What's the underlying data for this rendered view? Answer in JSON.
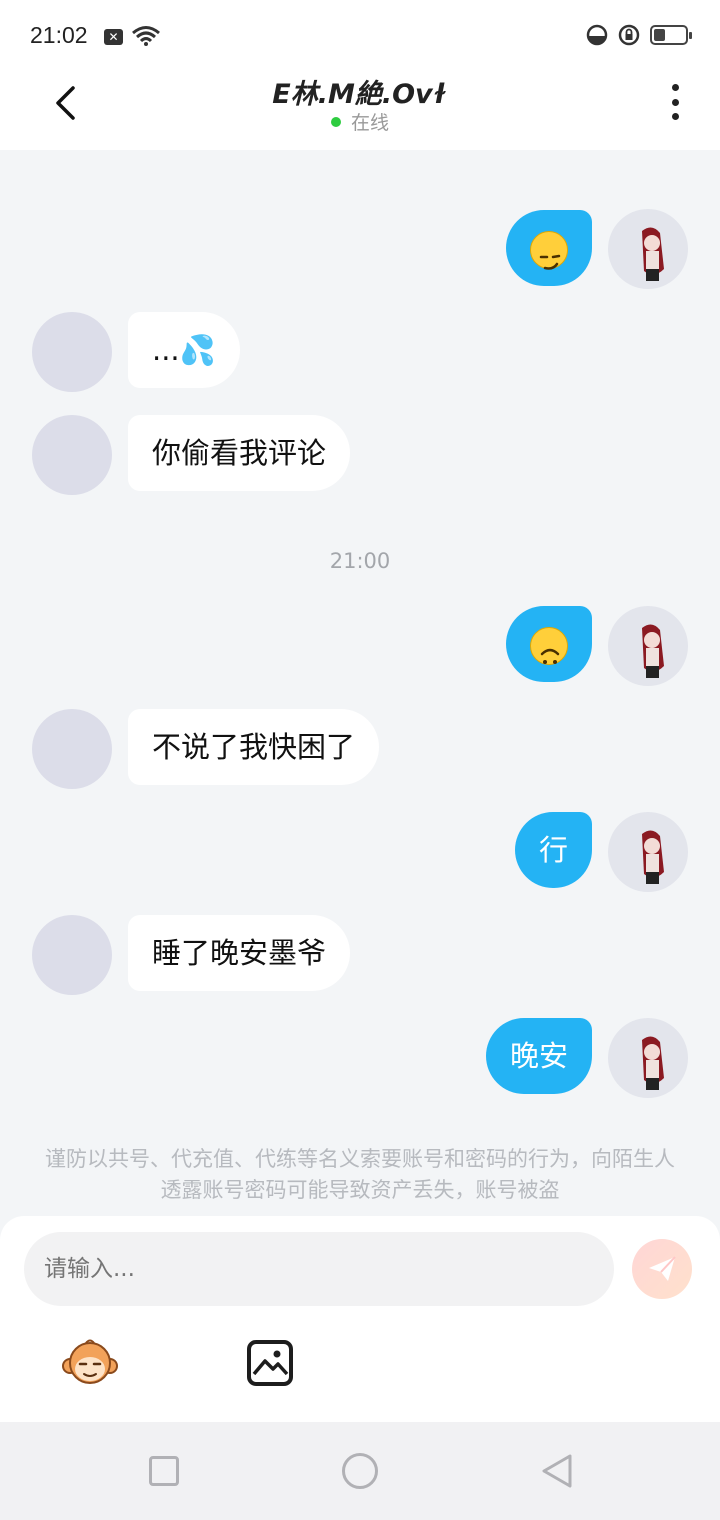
{
  "status_bar": {
    "time": "21:02",
    "battery_level": 0.35
  },
  "header": {
    "title": "E林.M絶.Ovɫ",
    "status": "在线"
  },
  "messages": [
    {
      "from": "me",
      "emoji": "smirking-face"
    },
    {
      "from": "them",
      "text": "...💦"
    },
    {
      "from": "them",
      "text": "你偷看我评论"
    },
    {
      "timestamp": "21:00"
    },
    {
      "from": "me",
      "emoji": "upside-down-face"
    },
    {
      "from": "them",
      "text": "不说了我快困了"
    },
    {
      "from": "me",
      "text": "行"
    },
    {
      "from": "them",
      "text": "睡了晚安墨爷"
    },
    {
      "from": "me",
      "text": "晚安"
    }
  ],
  "notice": "谨防以共号、代充值、代练等名义索要账号和密码的行为，向陌生人透露账号密码可能导致资产丢失，账号被盗",
  "composer": {
    "placeholder": "请输入..."
  },
  "colors": {
    "outgoing_bubble": "#24b3f4",
    "incoming_bubble": "#ffffff",
    "online_dot": "#2ecc40",
    "background": "#f3f5f7"
  }
}
